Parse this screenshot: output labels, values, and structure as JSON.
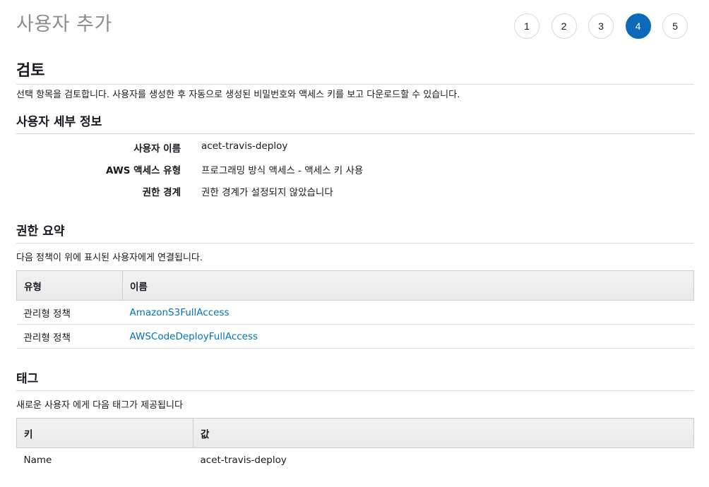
{
  "page": {
    "title": "사용자 추가"
  },
  "wizard": {
    "steps": [
      "1",
      "2",
      "3",
      "4",
      "5"
    ],
    "active_step": "4",
    "colors": {
      "active": "#0b6bb8"
    }
  },
  "review": {
    "title": "검토",
    "description": "선택 항목을 검토합니다. 사용자를 생성한 후 자동으로 생성된 비밀번호와 액세스 키를 보고 다운로드할 수 있습니다."
  },
  "user_details": {
    "title": "사용자 세부 정보",
    "rows": [
      {
        "label": "사용자 이름",
        "value": "acet-travis-deploy"
      },
      {
        "label": "AWS 액세스 유형",
        "value": "프로그래밍 방식 액세스 - 액세스 키 사용"
      },
      {
        "label": "권한 경계",
        "value": "권한 경계가 설정되지 않았습니다"
      }
    ]
  },
  "permissions": {
    "title": "권한 요약",
    "description": "다음 정책이 위에 표시된 사용자에게 연결됩니다.",
    "columns": [
      "유형",
      "이름"
    ],
    "rows": [
      {
        "type": "관리형 정책",
        "name": "AmazonS3FullAccess"
      },
      {
        "type": "관리형 정책",
        "name": "AWSCodeDeployFullAccess"
      }
    ]
  },
  "tags": {
    "title": "태그",
    "description": "새로운 사용자 에게 다음 태그가 제공됩니다",
    "columns": [
      "키",
      "값"
    ],
    "rows": [
      {
        "key": "Name",
        "value": "acet-travis-deploy"
      }
    ]
  }
}
